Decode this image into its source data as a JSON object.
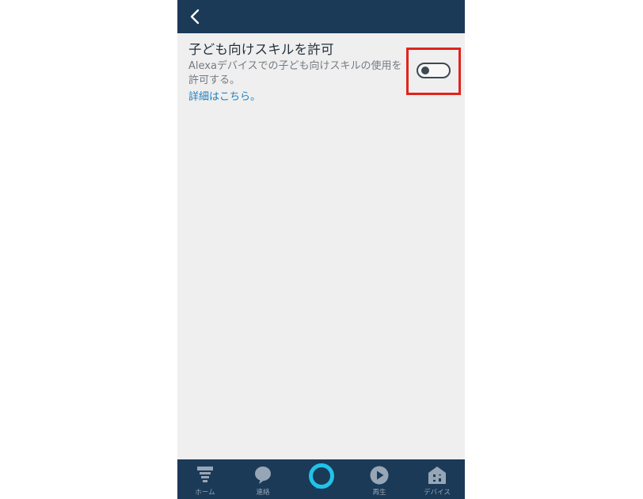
{
  "header": {
    "back_icon": "chevron-left-icon"
  },
  "setting": {
    "title": "子ども向けスキルを許可",
    "description": "Alexaデバイスでの子ども向けスキルの使用を許可する。",
    "link": "詳細はこちら。",
    "toggle_on": false
  },
  "colors": {
    "header_bg": "#1a3a57",
    "content_bg": "#efefef",
    "link": "#1f7fc0",
    "highlight_box": "#e0241b",
    "alexa_ring": "#22c3e8"
  },
  "nav": {
    "items": [
      {
        "label": "ホーム",
        "icon": "home-icon"
      },
      {
        "label": "連絡",
        "icon": "chat-bubble-icon"
      },
      {
        "label": "",
        "icon": "alexa-ring-icon"
      },
      {
        "label": "再生",
        "icon": "play-icon"
      },
      {
        "label": "デバイス",
        "icon": "devices-icon"
      }
    ]
  }
}
